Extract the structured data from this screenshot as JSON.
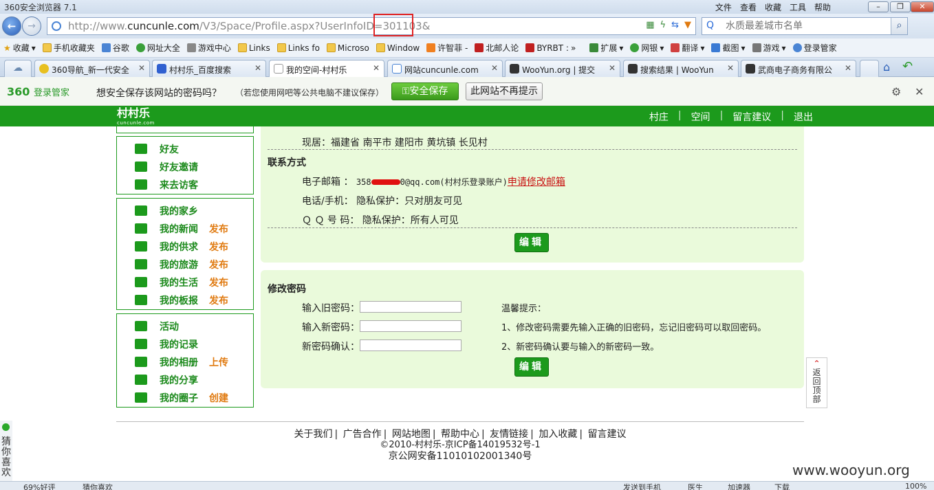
{
  "browser": {
    "title": "360安全浏览器 7.1",
    "menu": [
      "文件",
      "查看",
      "收藏",
      "工具",
      "帮助"
    ],
    "url_prefix": "http://www.",
    "url_domain": "cuncunle.com",
    "url_rest": "/V3/Space/Profile.aspx?UserInfoID=301103&",
    "search_placeholder": "水质最差城市名单"
  },
  "favorites": [
    "收藏",
    "手机收藏夹",
    "谷歌",
    "网址大全",
    "游戏中心",
    "Links",
    "Links fo",
    "Microso",
    "Window",
    "许智菲 -",
    "北邮人论",
    "BYRBT :",
    "扩展",
    "网银",
    "翻译",
    "截图",
    "游戏",
    "登录管家"
  ],
  "tabs": [
    "360导航_新一代安全",
    "村村乐_百度搜索",
    "我的空间-村村乐",
    "网站cuncunle.com",
    "WooYun.org | 提交",
    "搜索结果 | WooYun",
    "武商电子商务有限公"
  ],
  "password_bar": {
    "brand": "360",
    "brand_sub": "登录管家",
    "ask": "想安全保存该网站的密码吗？",
    "note": "（若您使用网吧等公共电脑不建议保存）",
    "save": "安全保存",
    "never": "此网站不再提示"
  },
  "site": {
    "logo": "村村乐",
    "logo_sub": "cuncunle.com",
    "nav": [
      "村庄",
      "空间",
      "留言建议",
      "退出"
    ]
  },
  "sidebar": {
    "group1": [
      {
        "label": "好友",
        "link": ""
      },
      {
        "label": "好友邀请",
        "link": ""
      },
      {
        "label": "来去访客",
        "link": ""
      }
    ],
    "group2": [
      {
        "label": "我的家乡",
        "link": ""
      },
      {
        "label": "我的新闻",
        "link": "发布"
      },
      {
        "label": "我的供求",
        "link": "发布"
      },
      {
        "label": "我的旅游",
        "link": "发布"
      },
      {
        "label": "我的生活",
        "link": "发布"
      },
      {
        "label": "我的板报",
        "link": "发布"
      }
    ],
    "group3": [
      {
        "label": "活动",
        "link": ""
      },
      {
        "label": "我的记录",
        "link": ""
      },
      {
        "label": "我的相册",
        "link": "上传"
      },
      {
        "label": "我的分享",
        "link": ""
      },
      {
        "label": "我的圈子",
        "link": "创建"
      }
    ]
  },
  "profile": {
    "residence": "现居：福建省 南平市 建阳市 黄坑镇 长见村",
    "contact_title": "联系方式",
    "email_label": "电子邮箱 ：",
    "email_start": "358",
    "email_end": "0@qq.com",
    "email_note": "(村村乐登录账户)",
    "email_change": "申请修改邮箱",
    "phone": "电话/手机： 隐私保护：只对朋友可见",
    "qq": "Ｑ Ｑ 号 码： 隐私保护：所有人可见",
    "edit": "编辑"
  },
  "password": {
    "title": "修改密码",
    "old": "输入旧密码：",
    "new": "输入新密码：",
    "confirm": "新密码确认：",
    "tip_title": "温馨提示：",
    "tip1": "1、修改密码需要先输入正确的旧密码，忘记旧密码可以取回密码。",
    "tip2": "2、新密码确认要与输入的新密码一致。",
    "submit": "编辑"
  },
  "back_to_top": [
    "返",
    "回",
    "顶",
    "部"
  ],
  "footer": {
    "links": [
      "关于我们",
      "广告合作",
      "网站地图",
      "帮助中心",
      "友情链接",
      "加入收藏",
      "留言建议"
    ],
    "copyright": "©2010-村村乐-京ICP备14019532号-1",
    "police": "京公网安备11010102001340号"
  },
  "guess": [
    "猜",
    "你",
    "喜",
    "欢"
  ],
  "watermark": "www.wooyun.org",
  "status": {
    "rating": "69%好评",
    "guess": "猜你喜欢",
    "send_phone": "发送到手机",
    "doctor": "医生",
    "accel": "加速器",
    "download": "下载",
    "zoom": "100%"
  }
}
